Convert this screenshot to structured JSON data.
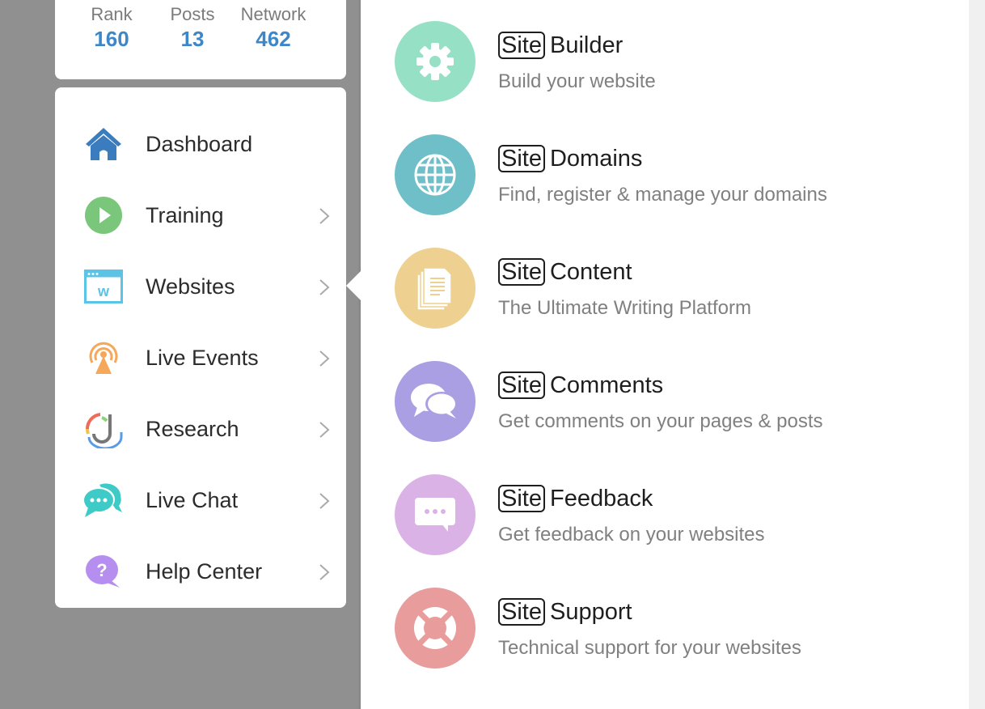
{
  "stats": [
    {
      "label": "Rank",
      "value": "160"
    },
    {
      "label": "Posts",
      "value": "13"
    },
    {
      "label": "Network",
      "value": "462"
    }
  ],
  "menu": {
    "items": [
      {
        "label": "Dashboard",
        "icon": "home-icon",
        "has_submenu": false
      },
      {
        "label": "Training",
        "icon": "play-icon",
        "has_submenu": true
      },
      {
        "label": "Websites",
        "icon": "website-icon",
        "has_submenu": true,
        "active": true
      },
      {
        "label": "Live Events",
        "icon": "broadcast-icon",
        "has_submenu": true
      },
      {
        "label": "Research",
        "icon": "research-icon",
        "has_submenu": true
      },
      {
        "label": "Live Chat",
        "icon": "chat-icon",
        "has_submenu": true
      },
      {
        "label": "Help Center",
        "icon": "help-icon",
        "has_submenu": true
      }
    ]
  },
  "services": {
    "brand_prefix": "Site",
    "items": [
      {
        "name": "Builder",
        "description": "Build your website",
        "icon": "gear-icon",
        "color": "#96e0c6"
      },
      {
        "name": "Domains",
        "description": "Find, register & manage your domains",
        "icon": "globe-icon",
        "color": "#6fbfc8"
      },
      {
        "name": "Content",
        "description": "The Ultimate Writing Platform",
        "icon": "documents-icon",
        "color": "#eed191"
      },
      {
        "name": "Comments",
        "description": "Get comments on your pages & posts",
        "icon": "comments-icon",
        "color": "#a99fe2"
      },
      {
        "name": "Feedback",
        "description": "Get feedback on your websites",
        "icon": "feedback-icon",
        "color": "#dbb2e6"
      },
      {
        "name": "Support",
        "description": "Technical support for your websites",
        "icon": "lifebuoy-icon",
        "color": "#e89c9c"
      }
    ]
  },
  "colors": {
    "stat_value": "#3d87c8",
    "overlay": "#909090"
  }
}
